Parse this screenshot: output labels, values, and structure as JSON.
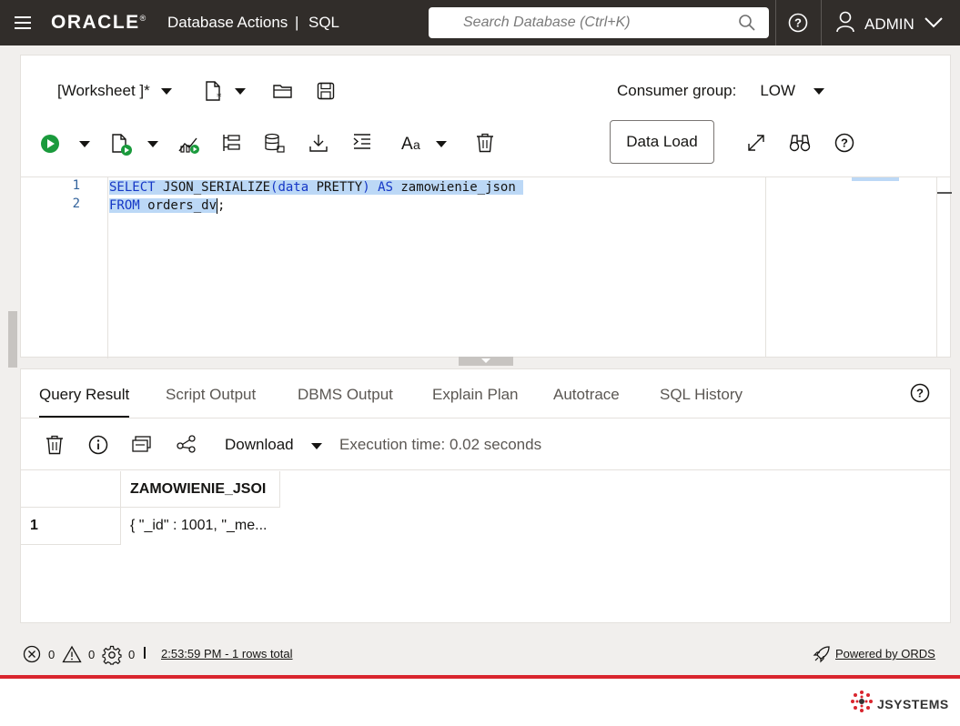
{
  "header": {
    "brand": "ORACLE",
    "brand_mark": "®",
    "app_title": "Database Actions",
    "separator": "|",
    "section": "SQL",
    "search_placeholder": "Search Database (Ctrl+K)",
    "user": "ADMIN"
  },
  "worksheet": {
    "name": "[Worksheet ]*",
    "consumer_group_label": "Consumer group:",
    "consumer_group_value": "LOW",
    "data_load_label": "Data Load",
    "run_color": "#1a9a3c"
  },
  "editor": {
    "lines": [
      {
        "number": "1",
        "kw1": "SELECT",
        "t1": " JSON_SERIALIZE",
        "kw2": "(data",
        "t2": " PRETTY",
        "kw3": ")",
        "t3": " ",
        "kw4": "AS",
        "t4": " zamowienie_json "
      },
      {
        "number": "2",
        "kw1": "FROM",
        "t1": " orders_dv",
        "rest": ";"
      }
    ]
  },
  "results": {
    "tabs": [
      {
        "label": "Query Result",
        "active": true
      },
      {
        "label": "Script Output"
      },
      {
        "label": "DBMS Output"
      },
      {
        "label": "Explain Plan"
      },
      {
        "label": "Autotrace"
      },
      {
        "label": "SQL History"
      }
    ],
    "download_label": "Download",
    "execution_time": "Execution time: 0.02 seconds",
    "columns": [
      "ZAMOWIENIE_JSOI"
    ],
    "rows": [
      {
        "num": "1",
        "value": "{ \"_id\" : 1001, \"_me..."
      }
    ]
  },
  "status": {
    "errors": "0",
    "warnings": "0",
    "tasks": "0",
    "summary": "2:53:59 PM - 1 rows total",
    "powered": "Powered by ORDS"
  },
  "footer": {
    "logo_text": "JSYSTEMS",
    "accent": "#d9252e"
  }
}
